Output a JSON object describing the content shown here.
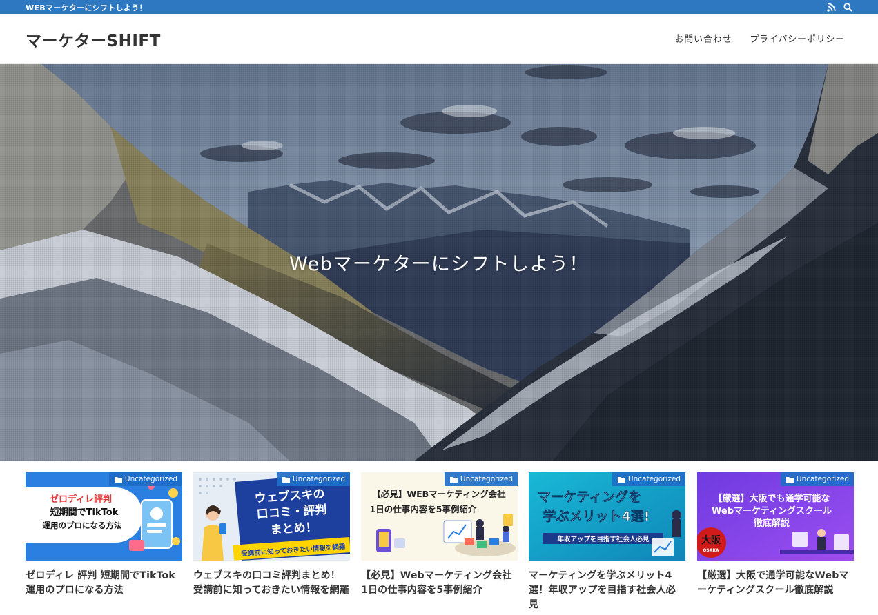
{
  "topbar": {
    "tagline": "WEBマーケターにシフトしよう！",
    "icons": [
      "rss-icon",
      "search-icon"
    ]
  },
  "header": {
    "site_title": "マーケターSHIFT",
    "nav": [
      {
        "label": "お問い合わせ"
      },
      {
        "label": "プライバシーポリシー"
      }
    ]
  },
  "hero": {
    "catchphrase": "Webマーケターにシフトしよう！"
  },
  "colors": {
    "topbar": "#2e78c2",
    "category_badge": "#1e6ec8"
  },
  "cards": [
    {
      "category": "Uncategorized",
      "title": "ゼロディレ 評判 短期間でTikTok運用のプロになる方法",
      "thumb": {
        "line1": "ゼロディレ評判",
        "line2": "短期間でTikTok",
        "line3": "運用のプロになる方法"
      }
    },
    {
      "category": "Uncategorized",
      "title": "ウェブスキの口コミ評判まとめ！受講前に知っておきたい情報を網羅",
      "thumb": {
        "line1": "ウェブスキの",
        "line2": "口コミ・評判",
        "line3": "まとめ！",
        "line4": "受講前に知っておきたい情報を網羅"
      }
    },
    {
      "category": "Uncategorized",
      "title": "【必見】Webマーケティング会社1日の仕事内容を5事例紹介",
      "thumb": {
        "line1": "【必見】WEBマーケティング会社",
        "line2": "1日の仕事内容を5事例紹介"
      }
    },
    {
      "category": "Uncategorized",
      "title": "マーケティングを学ぶメリット4選！年収アップを目指す社会人必見",
      "thumb": {
        "line1": "マーケティングを",
        "line2": "学ぶメリット4選!",
        "line3": "年収アップを目指す社会人必見"
      }
    },
    {
      "category": "Uncategorized",
      "title": "【厳選】大阪で通学可能なWebマーケティングスクール徹底解説",
      "thumb": {
        "line1": "【厳選】大阪でも通学可能な",
        "line2": "Webマーケティングスクール",
        "line3": "徹底解説",
        "badge": "大阪",
        "badge_sub": "OSAKA"
      }
    }
  ]
}
